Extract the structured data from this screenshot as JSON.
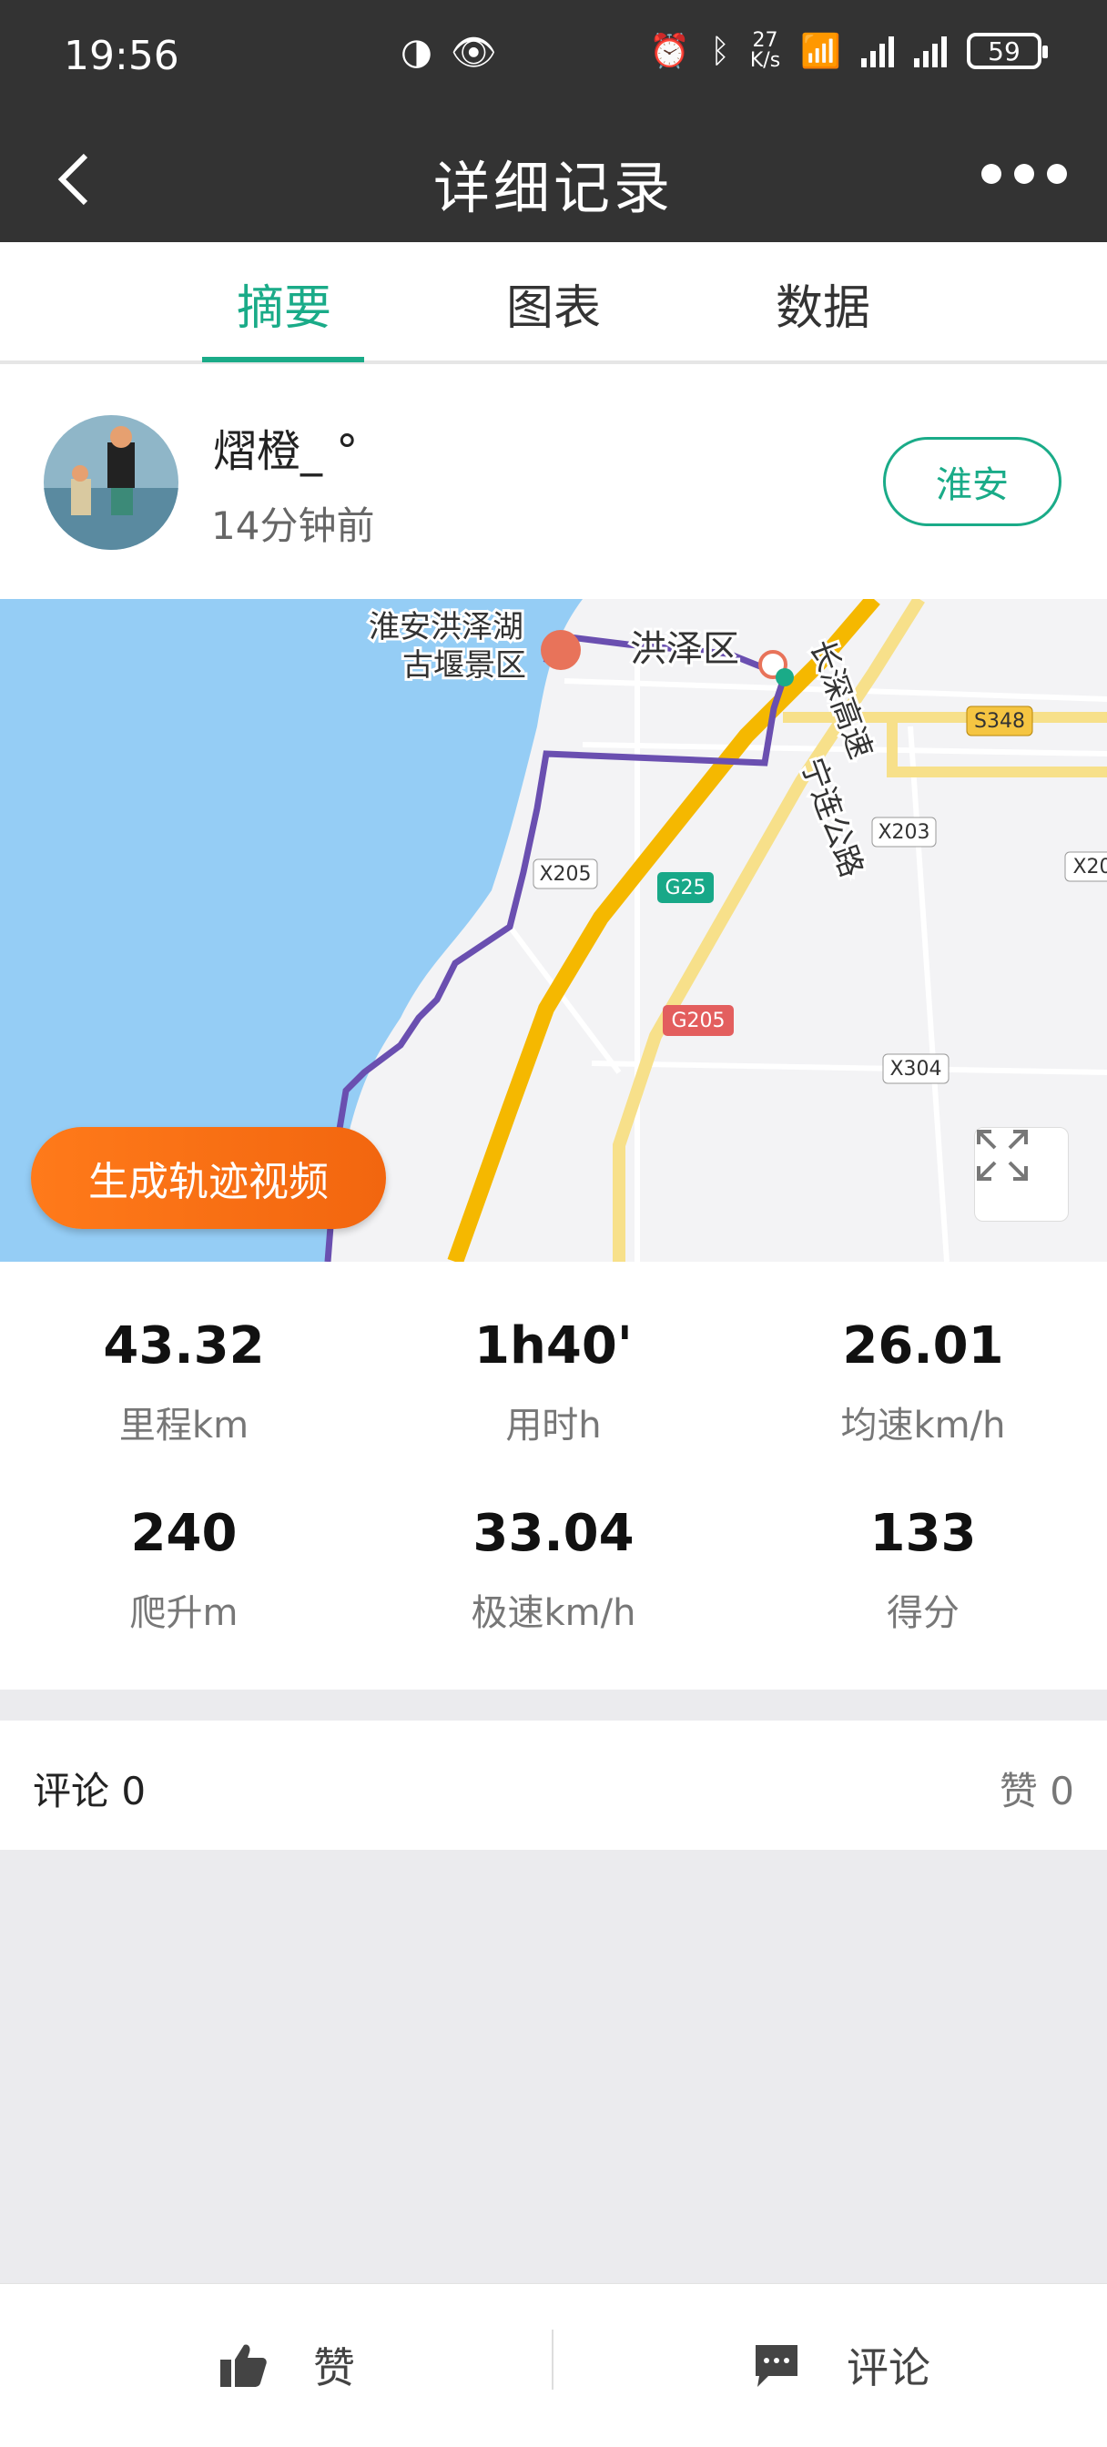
{
  "status_bar": {
    "time": "19:56",
    "net_speed_value": "27",
    "net_speed_unit": "K/s",
    "battery": "59"
  },
  "header": {
    "title": "详细记录"
  },
  "tabs": [
    {
      "label": "摘要"
    },
    {
      "label": "图表"
    },
    {
      "label": "数据"
    }
  ],
  "user": {
    "name": "熠橙_ °",
    "time_ago": "14分钟前",
    "city_button": "淮安"
  },
  "map": {
    "labels": {
      "scenic": "淮安洪泽湖\n古堰景区",
      "scenic_line1": "淮安洪泽湖",
      "scenic_line2": "古堰景区",
      "district": "洪泽区",
      "end_marker": "终",
      "expressway_1": "长深高速",
      "expressway_2": "宁连公路",
      "roads": [
        "S348",
        "X203",
        "X205",
        "G25",
        "G205",
        "X304",
        "X20"
      ]
    },
    "generate_video_button": "生成轨迹视频",
    "route_color": "#6a4fb0"
  },
  "stats": [
    {
      "value": "43.32",
      "label": "里程km"
    },
    {
      "value": "1h40'",
      "label": "用时h"
    },
    {
      "value": "26.01",
      "label": "均速km/h"
    },
    {
      "value": "240",
      "label": "爬升m"
    },
    {
      "value": "33.04",
      "label": "极速km/h"
    },
    {
      "value": "133",
      "label": "得分"
    }
  ],
  "comments": {
    "comment_label": "评论 0",
    "like_label": "赞 0"
  },
  "bottom_bar": {
    "like": "赞",
    "comment": "评论"
  },
  "colors": {
    "accent": "#1aab88",
    "header_bg": "#333333",
    "orange": "#f2660f"
  }
}
